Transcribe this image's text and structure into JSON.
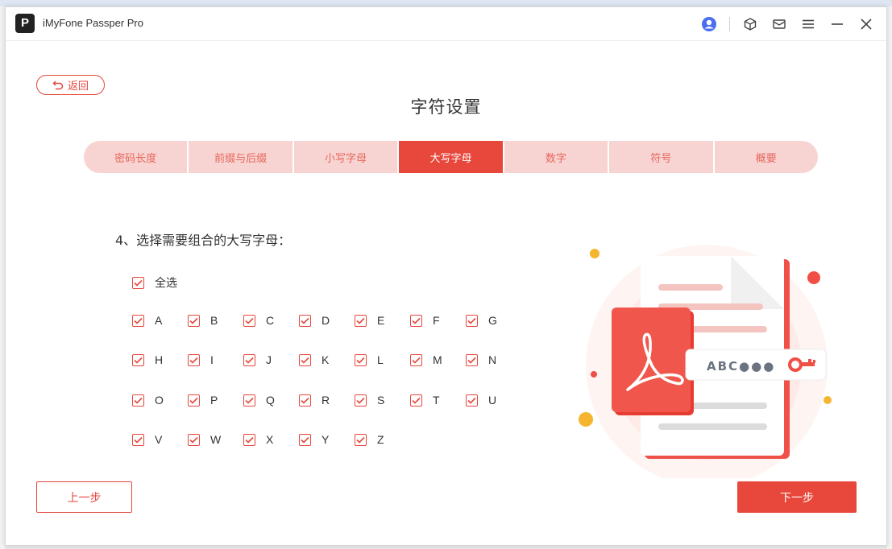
{
  "app": {
    "logo_letter": "P",
    "title": "iMyFone Passper Pro"
  },
  "titlebar_icons": [
    "account-icon",
    "package-icon",
    "mail-icon",
    "menu-icon",
    "minimize-icon",
    "close-icon"
  ],
  "back_button": {
    "label": "返回"
  },
  "page_title": "字符设置",
  "steps": [
    {
      "label": "密码长度",
      "active": false
    },
    {
      "label": "前缀与后缀",
      "active": false
    },
    {
      "label": "小写字母",
      "active": false
    },
    {
      "label": "大写字母",
      "active": true
    },
    {
      "label": "数字",
      "active": false
    },
    {
      "label": "符号",
      "active": false
    },
    {
      "label": "概要",
      "active": false
    }
  ],
  "section_label": "4、选择需要组合的大写字母：",
  "select_all": {
    "label": "全选",
    "checked": true
  },
  "letters": [
    {
      "label": "A",
      "checked": true
    },
    {
      "label": "B",
      "checked": true
    },
    {
      "label": "C",
      "checked": true
    },
    {
      "label": "D",
      "checked": true
    },
    {
      "label": "E",
      "checked": true
    },
    {
      "label": "F",
      "checked": true
    },
    {
      "label": "G",
      "checked": true
    },
    {
      "label": "H",
      "checked": true
    },
    {
      "label": "I",
      "checked": true
    },
    {
      "label": "J",
      "checked": true
    },
    {
      "label": "K",
      "checked": true
    },
    {
      "label": "L",
      "checked": true
    },
    {
      "label": "M",
      "checked": true
    },
    {
      "label": "N",
      "checked": true
    },
    {
      "label": "O",
      "checked": true
    },
    {
      "label": "P",
      "checked": true
    },
    {
      "label": "Q",
      "checked": true
    },
    {
      "label": "R",
      "checked": true
    },
    {
      "label": "S",
      "checked": true
    },
    {
      "label": "T",
      "checked": true
    },
    {
      "label": "U",
      "checked": true
    },
    {
      "label": "V",
      "checked": true
    },
    {
      "label": "W",
      "checked": true
    },
    {
      "label": "X",
      "checked": true
    },
    {
      "label": "Y",
      "checked": true
    },
    {
      "label": "Z",
      "checked": true
    }
  ],
  "illustration": {
    "password_text": "ABC●●●",
    "pdf_icon": "pdf-icon",
    "key_icon": "key-icon"
  },
  "prev_button": {
    "label": "上一步"
  },
  "next_button": {
    "label": "下一步"
  },
  "colors": {
    "accent": "#e8473b",
    "accent_light": "#f7d4d1",
    "text": "#333333"
  }
}
